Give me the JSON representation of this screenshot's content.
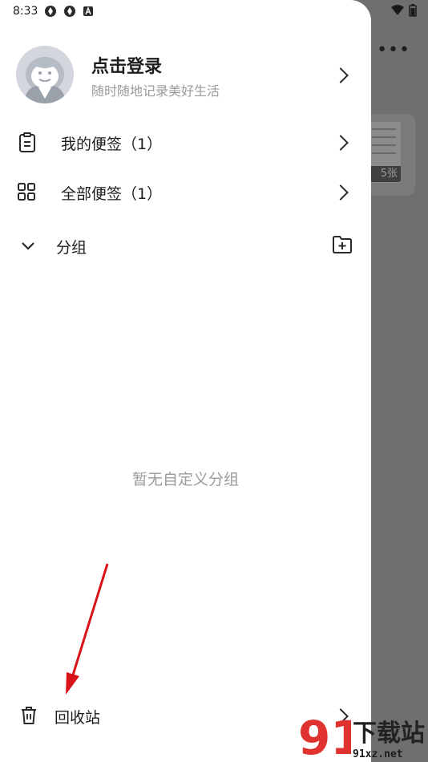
{
  "status_bar": {
    "time": "8:33"
  },
  "profile": {
    "title": "点击登录",
    "subtitle": "随时随地记录美好生活"
  },
  "menu": {
    "my_notes": "我的便签（1）",
    "all_notes": "全部便签（1）",
    "groups": "分组"
  },
  "groups_empty": "暂无自定义分组",
  "recycle_bin": "回收站",
  "background": {
    "card_count": "5张"
  },
  "watermark": {
    "title": "下载站",
    "site": "91xz.net"
  }
}
